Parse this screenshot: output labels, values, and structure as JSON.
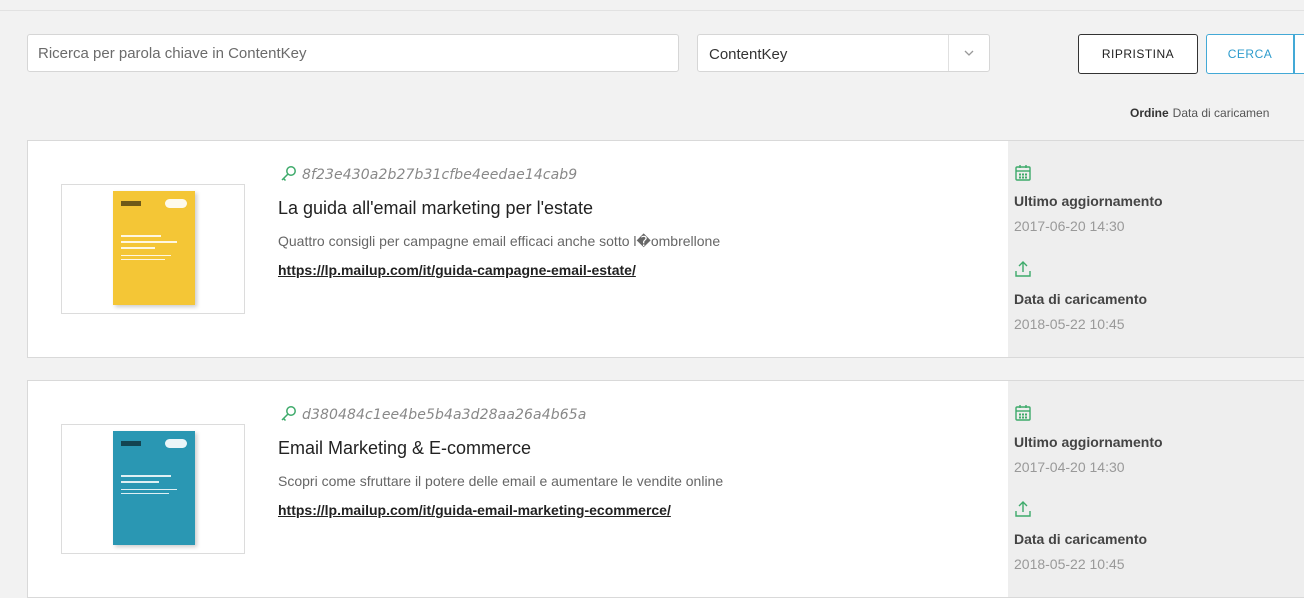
{
  "search": {
    "placeholder": "Ricerca per parola chiave in ContentKey"
  },
  "filter": {
    "selected": "ContentKey"
  },
  "buttons": {
    "reset": "RIPRISTINA",
    "search": "CERCA"
  },
  "sort": {
    "label": "Ordine",
    "value": "Data di caricamen"
  },
  "colors": {
    "accent": "#2f9ccc",
    "icon_green": "#3daa6a"
  },
  "icons": {
    "key": "key-icon",
    "calendar": "calendar-icon",
    "upload": "upload-icon",
    "chevron": "chevron-down-icon"
  },
  "items": [
    {
      "key": "8f23e430a2b27b31cfbe4eedae14cab9",
      "title": "La guida all'email marketing per l'estate",
      "description": "Quattro consigli per campagne email efficaci anche sotto l�ombrellone",
      "url": "https://lp.mailup.com/it/guida-campagne-email-estate/",
      "updated_label": "Ultimo aggiornamento",
      "updated_value": "2017-06-20 14:30",
      "uploaded_label": "Data di caricamento",
      "uploaded_value": "2018-05-22 10:45"
    },
    {
      "key": "d380484c1ee4be5b4a3d28aa26a4b65a",
      "title": "Email Marketing & E-commerce",
      "description": "Scopri come sfruttare il potere delle email e aumentare le vendite online",
      "url": "https://lp.mailup.com/it/guida-email-marketing-ecommerce/",
      "updated_label": "Ultimo aggiornamento",
      "updated_value": "2017-04-20 14:30",
      "uploaded_label": "Data di caricamento",
      "uploaded_value": "2018-05-22 10:45"
    }
  ]
}
